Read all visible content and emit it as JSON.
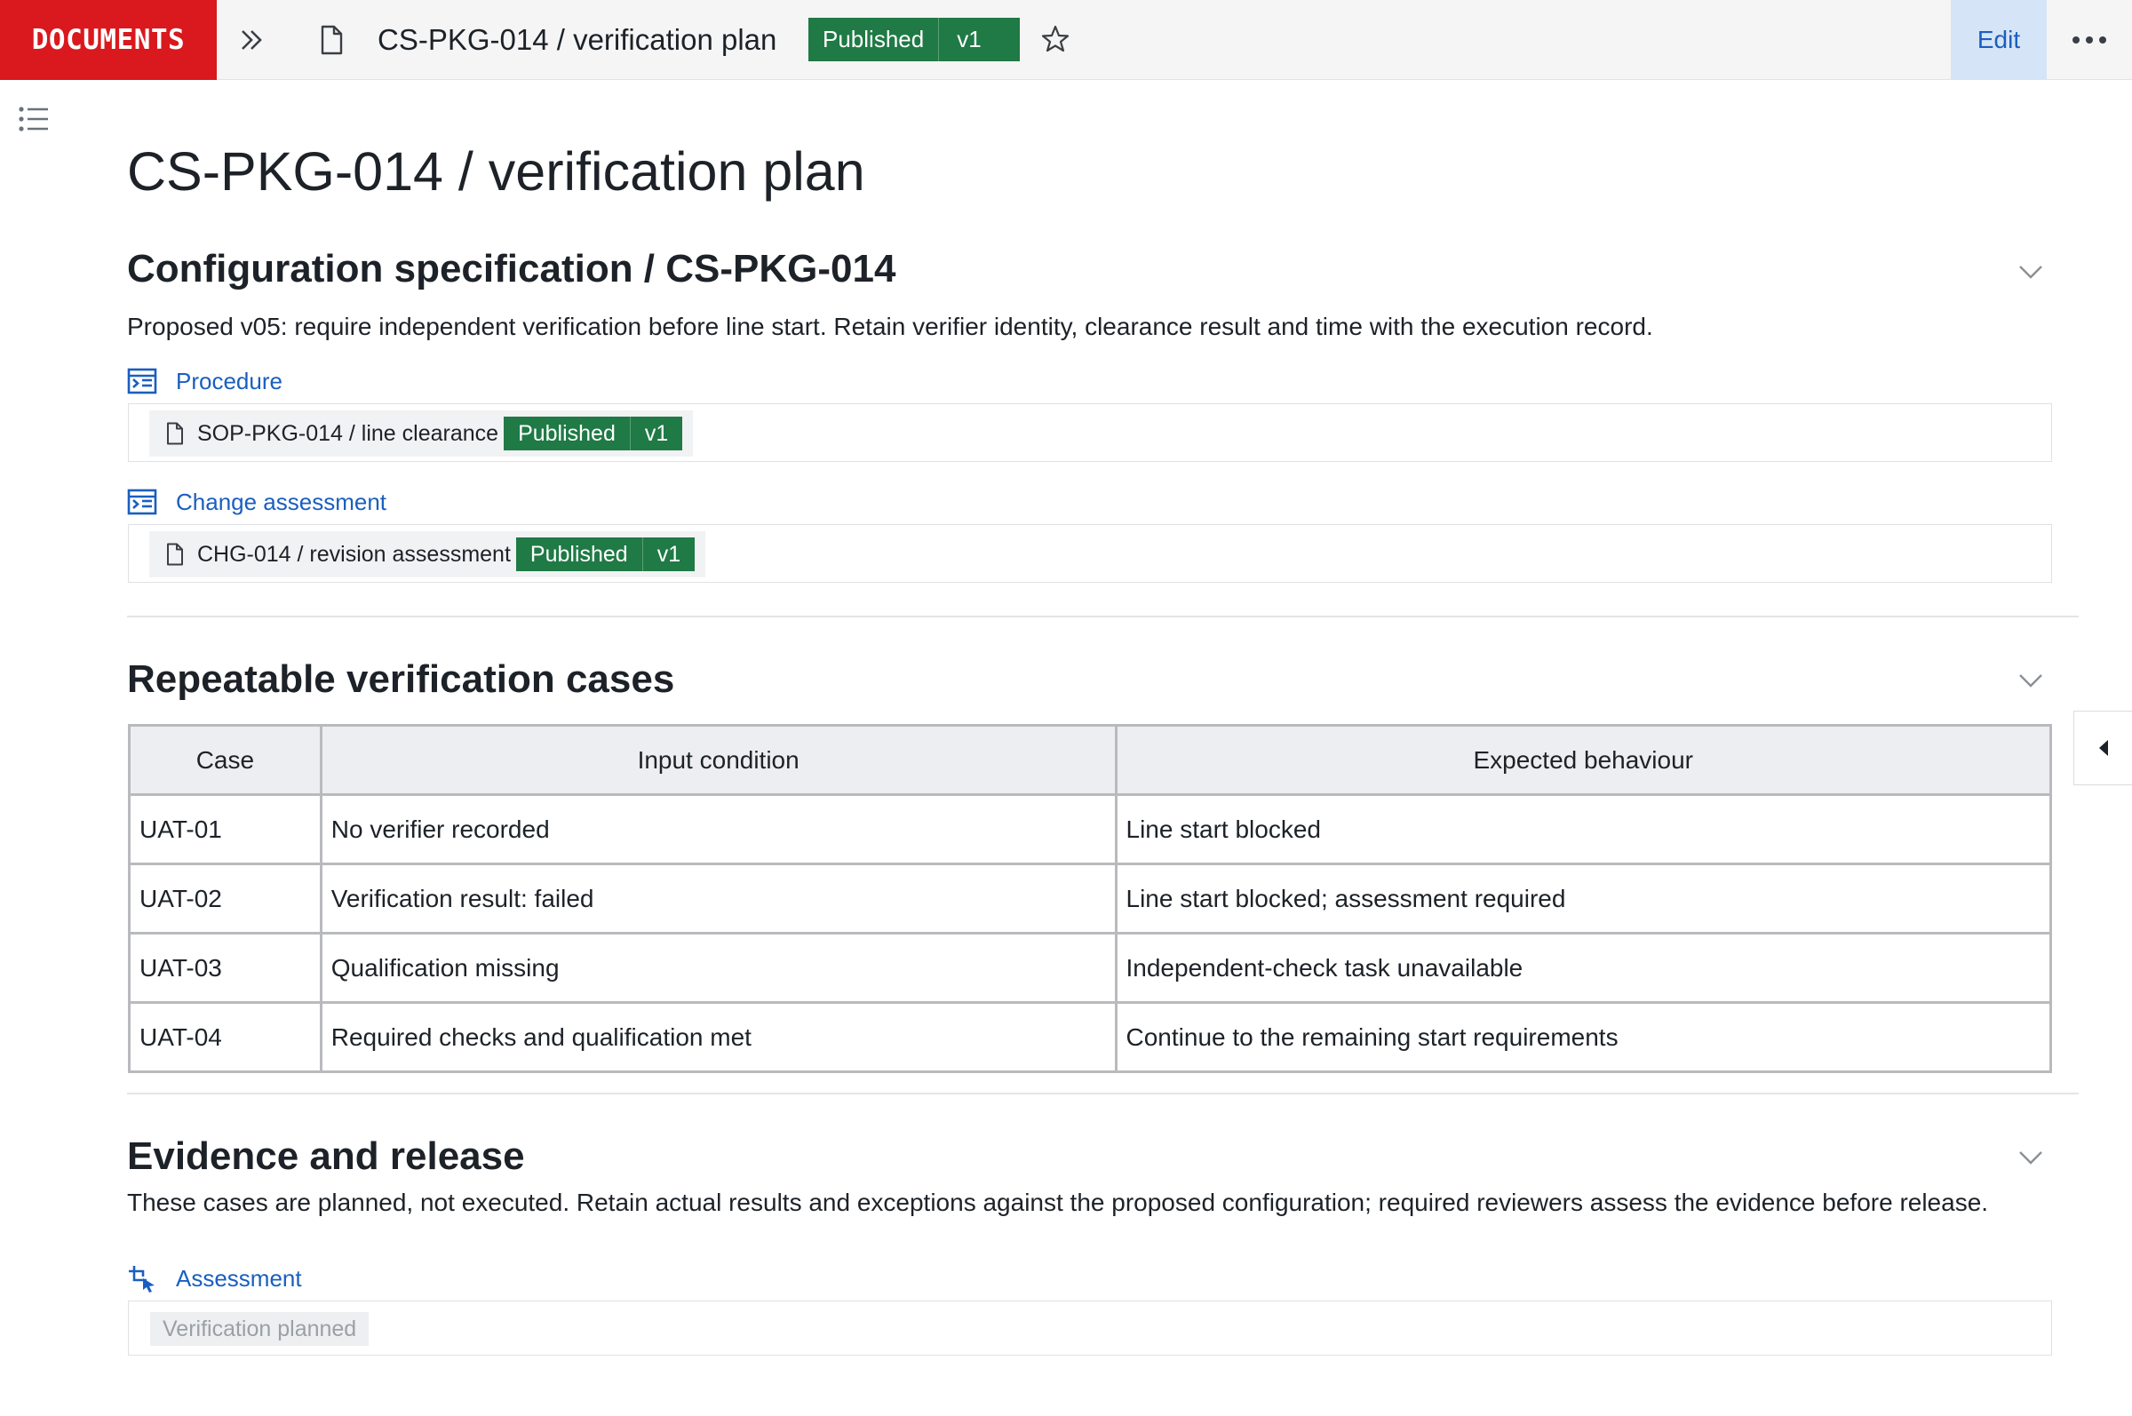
{
  "app": {
    "brand": "DOCUMENTS",
    "edit_label": "Edit"
  },
  "document": {
    "title": "CS-PKG-014 / verification plan",
    "status": "Published",
    "version": "v1"
  },
  "sections": {
    "config": {
      "heading": "Configuration specification / CS-PKG-014",
      "text": "Proposed v05: require independent verification before line start. Retain verifier identity, clearance result and time with the execution record.",
      "procedure": {
        "label": "Procedure",
        "ref_title": "SOP-PKG-014 / line clearance",
        "ref_status": "Published",
        "ref_version": "v1"
      },
      "change": {
        "label": "Change assessment",
        "ref_title": "CHG-014 / revision assessment",
        "ref_status": "Published",
        "ref_version": "v1"
      }
    },
    "cases": {
      "heading": "Repeatable verification cases",
      "columns": [
        "Case",
        "Input condition",
        "Expected behaviour"
      ],
      "rows": [
        [
          "UAT-01",
          "No verifier recorded",
          "Line start blocked"
        ],
        [
          "UAT-02",
          "Verification result: failed",
          "Line start blocked; assessment required"
        ],
        [
          "UAT-03",
          "Qualification missing",
          "Independent-check task unavailable"
        ],
        [
          "UAT-04",
          "Required checks and qualification met",
          "Continue to the remaining start requirements"
        ]
      ]
    },
    "evidence": {
      "heading": "Evidence and release",
      "text": "These cases are planned, not executed. Retain actual results and exceptions against the proposed configuration; required reviewers assess the evidence before release.",
      "assessment": {
        "label": "Assessment",
        "value": "Verification planned"
      }
    }
  },
  "colors": {
    "brand": "#d9191d",
    "published": "#1f7a45",
    "link": "#1a5fbf",
    "edit_bg": "#d6e4f7"
  },
  "icons": [
    "chevrons-right-icon",
    "document-icon",
    "star-icon",
    "more-icon",
    "toc-list-icon",
    "chevron-down-icon",
    "caret-left-icon",
    "field-list-icon",
    "cursor-crop-icon"
  ]
}
